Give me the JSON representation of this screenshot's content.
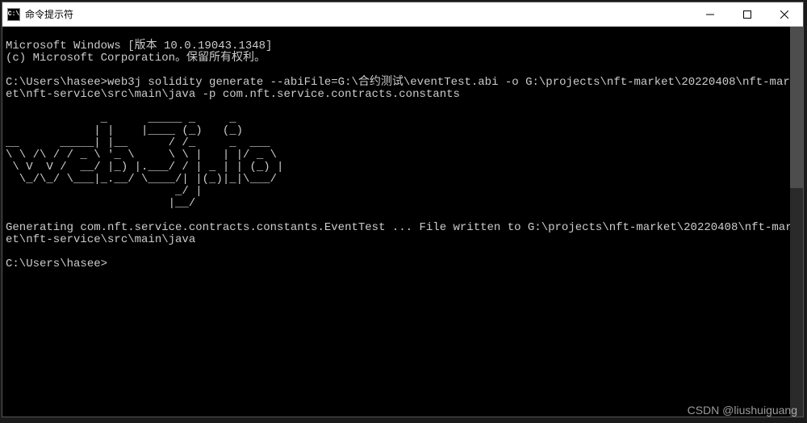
{
  "window": {
    "title": "命令提示符",
    "icon_label": "C:\\"
  },
  "terminal": {
    "line1": "Microsoft Windows [版本 10.0.19043.1348]",
    "line2": "(c) Microsoft Corporation。保留所有权利。",
    "blank1": "",
    "command_line": "C:\\Users\\hasee>web3j solidity generate --abiFile=G:\\合约测试\\eventTest.abi -o G:\\projects\\nft-market\\20220408\\nft-market\\nft-service\\src\\main\\java -p com.nft.service.contracts.constants",
    "blank2": "",
    "ascii_art": "              _      _____ _     _        \n             | |    |____ (_)   (_)       \n__      _____| |__      / /_     _  ___   \n\\ \\ /\\ / / _ \\ '_ \\     \\ \\ |   | |/ _ \\  \n \\ V  V /  __/ |_) |.___/ / | _ | | (_) | \n  \\_/\\_/ \\___|_.__/ \\____/| |(_)|_|\\___/  \n                         _/ |             \n                        |__/              ",
    "blank3": "",
    "output_line": "Generating com.nft.service.contracts.constants.EventTest ... File written to G:\\projects\\nft-market\\20220408\\nft-market\\nft-service\\src\\main\\java",
    "blank4": "",
    "prompt": "C:\\Users\\hasee>"
  },
  "watermark": "CSDN @liushuiguang"
}
